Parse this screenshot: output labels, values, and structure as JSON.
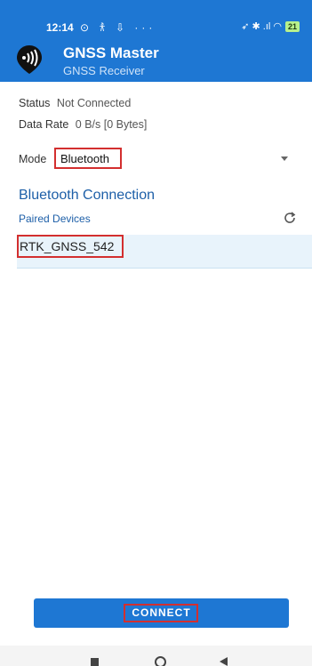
{
  "statusbar": {
    "time": "12:14",
    "left_icons": "⊙ 𐀪 ⇩ ···",
    "right_icons": "➶ ✱ .ıl ◠",
    "battery": "21"
  },
  "header": {
    "title": "GNSS Master",
    "subtitle": "GNSS Receiver",
    "logo_icon": "gnss-pin-icon",
    "color": "#1e77d3"
  },
  "status": {
    "label": "Status",
    "value": "Not Connected"
  },
  "data_rate": {
    "label": "Data Rate",
    "value": "0 B/s [0 Bytes]"
  },
  "mode": {
    "label": "Mode",
    "value": "Bluetooth"
  },
  "bluetooth": {
    "title": "Bluetooth Connection",
    "paired_label": "Paired Devices",
    "devices": [
      {
        "name": "RTK_GNSS_542"
      }
    ]
  },
  "connect_button": {
    "label": "CONNECT"
  },
  "annotation_color": "#d32f2f"
}
